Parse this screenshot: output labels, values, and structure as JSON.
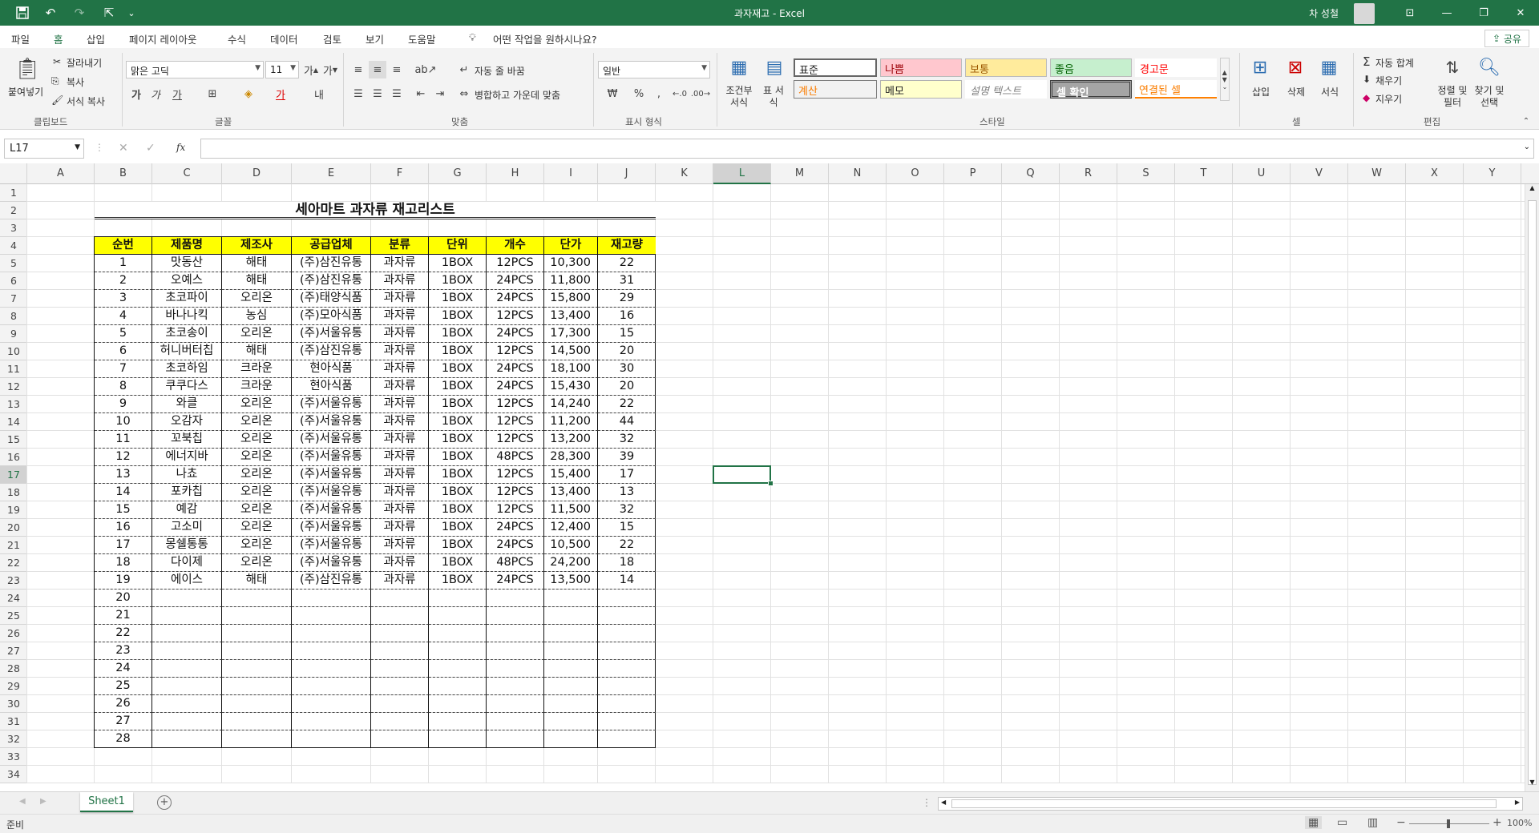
{
  "window": {
    "title": "과자재고  -  Excel",
    "user": "차 성철",
    "minimize": "—",
    "restore": "❐",
    "close": "✕",
    "ribbon_display": "⊡"
  },
  "menu": {
    "tabs": [
      "파일",
      "홈",
      "삽입",
      "페이지 레이아웃",
      "수식",
      "데이터",
      "검토",
      "보기",
      "도움말"
    ],
    "active": "홈",
    "tellme": "어떤 작업을 원하시나요?",
    "share": "공유"
  },
  "ribbon": {
    "clipboard": {
      "paste": "붙여넣기",
      "cut": "잘라내기",
      "copy": "복사",
      "format_painter": "서식 복사",
      "label": "클립보드"
    },
    "font": {
      "name": "맑은 고딕",
      "size": "11",
      "label": "글꼴"
    },
    "alignment": {
      "wrap": "자동 줄 바꿈",
      "merge": "병합하고 가운데 맞춤",
      "label": "맞춤"
    },
    "number": {
      "format": "일반",
      "label": "표시 형식"
    },
    "styles": {
      "conditional": "조건부 서식",
      "table": "표 서식",
      "label": "스타일",
      "cells": [
        "표준",
        "나쁨",
        "보통",
        "좋음",
        "경고문",
        "계산",
        "메모",
        "설명 텍스트",
        "셀 확인",
        "연결된 셀"
      ]
    },
    "cells": {
      "insert": "삽입",
      "delete": "삭제",
      "format": "서식",
      "label": "셀"
    },
    "editing": {
      "autosum": "자동 합계",
      "fill": "채우기",
      "clear": "지우기",
      "sort": "정렬 및 필터",
      "find": "찾기 및 선택",
      "label": "편집"
    }
  },
  "formula_bar": {
    "name_box": "L17",
    "fx": "fx",
    "value": ""
  },
  "grid": {
    "columns": [
      "A",
      "B",
      "C",
      "D",
      "E",
      "F",
      "G",
      "H",
      "I",
      "J",
      "K",
      "L",
      "M",
      "N",
      "O",
      "P",
      "Q",
      "R",
      "S",
      "T",
      "U",
      "V",
      "W",
      "X",
      "Y"
    ],
    "rows": [
      "1",
      "2",
      "3",
      "4",
      "5",
      "6",
      "7",
      "8",
      "9",
      "10",
      "11",
      "12",
      "13",
      "14",
      "15",
      "16",
      "17",
      "18",
      "19",
      "20",
      "21",
      "22",
      "23",
      "24",
      "25",
      "26",
      "27",
      "28",
      "29",
      "30",
      "31",
      "32",
      "33",
      "34"
    ],
    "selected_col": "L",
    "selected_row": "17"
  },
  "sheet_title": "세아마트 과자류 재고리스트",
  "table": {
    "headers": [
      "순번",
      "제품명",
      "제조사",
      "공급업체",
      "분류",
      "단위",
      "개수",
      "단가",
      "재고량"
    ],
    "header_bg": "#ffff00",
    "rows": [
      [
        "1",
        "맛동산",
        "해태",
        "(주)삼진유통",
        "과자류",
        "1BOX",
        "12PCS",
        "10,300",
        "22"
      ],
      [
        "2",
        "오예스",
        "해태",
        "(주)삼진유통",
        "과자류",
        "1BOX",
        "24PCS",
        "11,800",
        "31"
      ],
      [
        "3",
        "초코파이",
        "오리온",
        "(주)태양식품",
        "과자류",
        "1BOX",
        "24PCS",
        "15,800",
        "29"
      ],
      [
        "4",
        "바나나킥",
        "농심",
        "(주)모아식품",
        "과자류",
        "1BOX",
        "12PCS",
        "13,400",
        "16"
      ],
      [
        "5",
        "초코송이",
        "오리온",
        "(주)서울유통",
        "과자류",
        "1BOX",
        "24PCS",
        "17,300",
        "15"
      ],
      [
        "6",
        "허니버터칩",
        "해태",
        "(주)삼진유통",
        "과자류",
        "1BOX",
        "12PCS",
        "14,500",
        "20"
      ],
      [
        "7",
        "초코하임",
        "크라운",
        "현아식품",
        "과자류",
        "1BOX",
        "24PCS",
        "18,100",
        "30"
      ],
      [
        "8",
        "쿠쿠다스",
        "크라운",
        "현아식품",
        "과자류",
        "1BOX",
        "24PCS",
        "15,430",
        "20"
      ],
      [
        "9",
        "와클",
        "오리온",
        "(주)서울유통",
        "과자류",
        "1BOX",
        "12PCS",
        "14,240",
        "22"
      ],
      [
        "10",
        "오감자",
        "오리온",
        "(주)서울유통",
        "과자류",
        "1BOX",
        "12PCS",
        "11,200",
        "44"
      ],
      [
        "11",
        "꼬북칩",
        "오리온",
        "(주)서울유통",
        "과자류",
        "1BOX",
        "12PCS",
        "13,200",
        "32"
      ],
      [
        "12",
        "에너지바",
        "오리온",
        "(주)서울유통",
        "과자류",
        "1BOX",
        "48PCS",
        "28,300",
        "39"
      ],
      [
        "13",
        "나쵸",
        "오리온",
        "(주)서울유통",
        "과자류",
        "1BOX",
        "12PCS",
        "15,400",
        "17"
      ],
      [
        "14",
        "포카칩",
        "오리온",
        "(주)서울유통",
        "과자류",
        "1BOX",
        "12PCS",
        "13,400",
        "13"
      ],
      [
        "15",
        "예감",
        "오리온",
        "(주)서울유통",
        "과자류",
        "1BOX",
        "12PCS",
        "11,500",
        "32"
      ],
      [
        "16",
        "고소미",
        "오리온",
        "(주)서울유통",
        "과자류",
        "1BOX",
        "24PCS",
        "12,400",
        "15"
      ],
      [
        "17",
        "몽쉘통통",
        "오리온",
        "(주)서울유통",
        "과자류",
        "1BOX",
        "24PCS",
        "10,500",
        "22"
      ],
      [
        "18",
        "다이제",
        "오리온",
        "(주)서울유통",
        "과자류",
        "1BOX",
        "48PCS",
        "24,200",
        "18"
      ],
      [
        "19",
        "에이스",
        "해태",
        "(주)삼진유통",
        "과자류",
        "1BOX",
        "24PCS",
        "13,500",
        "14"
      ],
      [
        "20",
        "",
        "",
        "",
        "",
        "",
        "",
        "",
        ""
      ],
      [
        "21",
        "",
        "",
        "",
        "",
        "",
        "",
        "",
        ""
      ],
      [
        "22",
        "",
        "",
        "",
        "",
        "",
        "",
        "",
        ""
      ],
      [
        "23",
        "",
        "",
        "",
        "",
        "",
        "",
        "",
        ""
      ],
      [
        "24",
        "",
        "",
        "",
        "",
        "",
        "",
        "",
        ""
      ],
      [
        "25",
        "",
        "",
        "",
        "",
        "",
        "",
        "",
        ""
      ],
      [
        "26",
        "",
        "",
        "",
        "",
        "",
        "",
        "",
        ""
      ],
      [
        "27",
        "",
        "",
        "",
        "",
        "",
        "",
        "",
        ""
      ],
      [
        "28",
        "",
        "",
        "",
        "",
        "",
        "",
        "",
        ""
      ]
    ]
  },
  "sheets": {
    "tabs": [
      "Sheet1"
    ],
    "active": "Sheet1",
    "add": "+"
  },
  "status": {
    "ready": "준비",
    "zoom": "100%"
  }
}
